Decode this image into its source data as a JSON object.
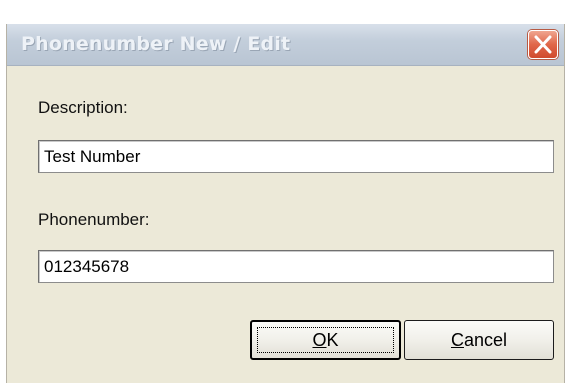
{
  "window": {
    "title": "Phonenumber New / Edit",
    "close_icon": "close-x-icon"
  },
  "form": {
    "description_label": "Description:",
    "description_value": "Test Number",
    "phonenumber_label": "Phonenumber:",
    "phonenumber_value": "012345678"
  },
  "buttons": {
    "ok": {
      "accel": "O",
      "rest": "K"
    },
    "cancel": {
      "accel": "C",
      "rest": "ancel"
    }
  },
  "colors": {
    "dialog_bg": "#ece9d8",
    "titlebar": "#c3cedb",
    "close_button": "#e0674a"
  }
}
